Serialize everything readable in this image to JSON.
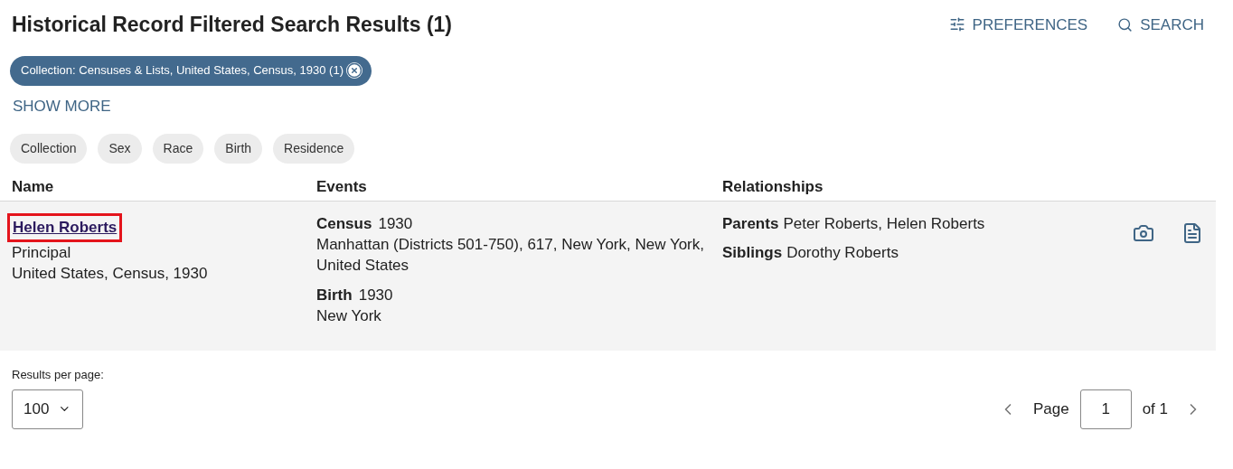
{
  "title": "Historical Record Filtered Search Results (1)",
  "header_actions": [
    {
      "kind": "preferences",
      "label": "PREFERENCES"
    },
    {
      "kind": "search",
      "label": "SEARCH"
    }
  ],
  "active_filter": {
    "label": "Collection: Censuses & Lists, United States, Census, 1930 (1)"
  },
  "show_more": "SHOW MORE",
  "filter_chips": [
    "Collection",
    "Sex",
    "Race",
    "Birth",
    "Residence"
  ],
  "table": {
    "columns": [
      "Name",
      "Events",
      "Relationships"
    ],
    "rows": [
      {
        "name": "Helen Roberts",
        "highlighted": true,
        "role": "Principal",
        "collection": "United States, Census, 1930",
        "events": [
          {
            "type": "Census",
            "year": "1930",
            "place": "Manhattan (Districts 501-750), 617, New York, New York, United States"
          },
          {
            "type": "Birth",
            "year": "1930",
            "place": "New York"
          }
        ],
        "relationships": [
          {
            "type": "Parents",
            "names": "Peter Roberts, Helen Roberts"
          },
          {
            "type": "Siblings",
            "names": "Dorothy Roberts"
          }
        ]
      }
    ]
  },
  "footer": {
    "per_page_label": "Results per page:",
    "per_page": "100",
    "page_label": "Page",
    "page": "1",
    "of": "of 1"
  }
}
